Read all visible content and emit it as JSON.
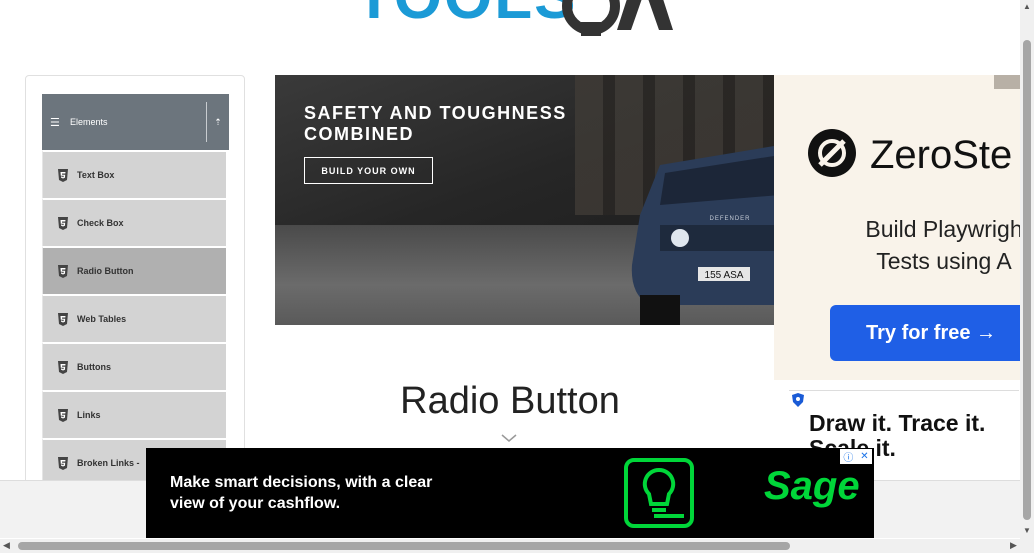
{
  "header": {
    "logo_text": "TOOLSQA"
  },
  "sidebar": {
    "group_label": "Elements",
    "items": [
      {
        "label": "Text Box",
        "active": false
      },
      {
        "label": "Check Box",
        "active": false
      },
      {
        "label": "Radio Button",
        "active": true
      },
      {
        "label": "Web Tables",
        "active": false
      },
      {
        "label": "Buttons",
        "active": false
      },
      {
        "label": "Links",
        "active": false
      },
      {
        "label": "Broken Links - ",
        "active": false
      }
    ]
  },
  "banner_ad": {
    "headline_line1": "SAFETY AND TOUGHNESS",
    "headline_line2": "COMBINED",
    "cta": "BUILD YOUR OWN",
    "plate": "155 ASA",
    "vehicle_badge": "DEFENDER"
  },
  "main": {
    "page_title": "Radio Button"
  },
  "right_ad": {
    "brand": "ZeroSte",
    "copy_line1": "Build Playwrigh",
    "copy_line2": "Tests using A",
    "button": "Try for free →"
  },
  "right_ad2": {
    "line1": "Draw it. Trace it.",
    "line2": "Scale it."
  },
  "bottom_ad": {
    "line1": "Make smart decisions, with a clear",
    "line2": "view of your cashflow.",
    "brand": "Sage",
    "adchoices_info": "ⓘ",
    "adchoices_close": "✕"
  },
  "colors": {
    "accent": "#1f5fe6",
    "sage_green": "#00d639",
    "sidebar_header": "#6c757d"
  }
}
